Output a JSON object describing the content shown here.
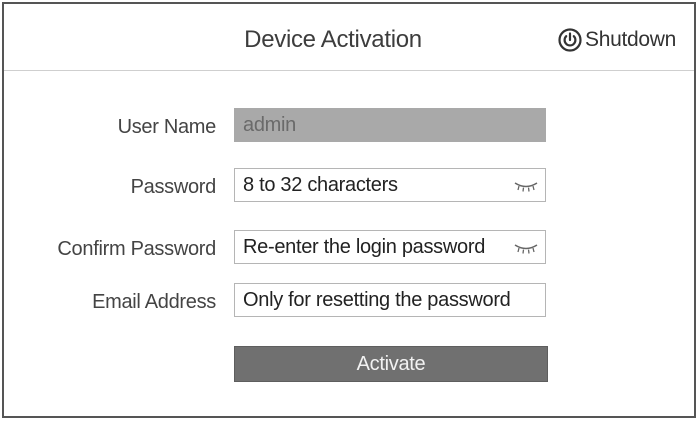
{
  "dialog": {
    "title": "Device Activation",
    "shutdown_label": "Shutdown",
    "shutdown_icon": "power-icon"
  },
  "form": {
    "username": {
      "label": "User Name",
      "value": "admin"
    },
    "password": {
      "label": "Password",
      "placeholder": "8 to 32 characters",
      "icon": "eye-closed-icon"
    },
    "confirm_password": {
      "label": "Confirm Password",
      "placeholder": "Re-enter the login password",
      "icon": "eye-closed-icon"
    },
    "email": {
      "label": "Email Address",
      "placeholder": "Only for resetting the password"
    },
    "activate_label": "Activate"
  },
  "colors": {
    "button_bg": "#707070",
    "readonly_field_bg": "#a9a9a9",
    "border": "#555555"
  }
}
